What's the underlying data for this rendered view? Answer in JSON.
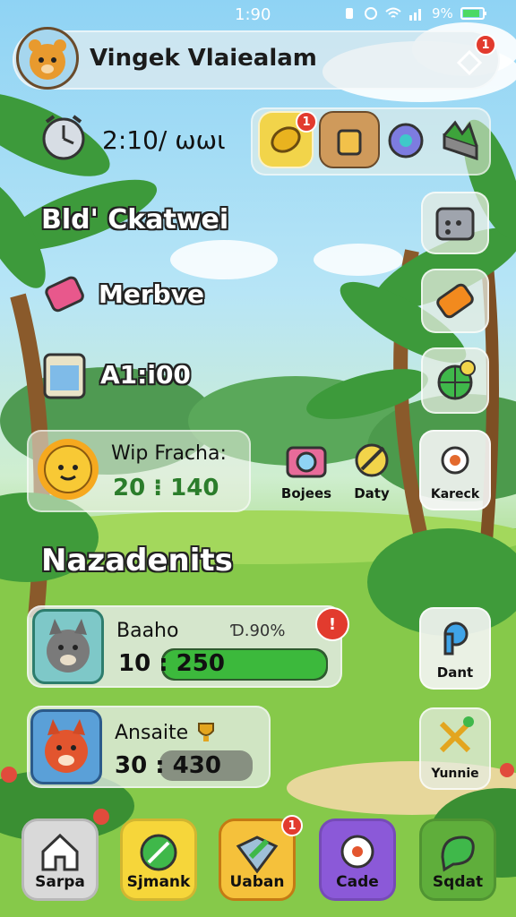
{
  "status_bar": {
    "time": "1:90",
    "battery_pct": "9%",
    "battery_level": 0.8
  },
  "header": {
    "player_name": "Vingek Vlaiealam",
    "badge": "1"
  },
  "top_row": {
    "time_label": "2:10/ ωωι",
    "shortcut_badge": "1"
  },
  "labels": {
    "section_title": "Bld' Ckatwei",
    "menu_label": "Merbve",
    "score_label": "A1:i00"
  },
  "wip_card": {
    "title": "Wip Fracha:",
    "progress_text": "20 ⁝ 140"
  },
  "mid_buttons": {
    "bojees": "Bojees",
    "daty": "Daty",
    "kareck": "Kareck"
  },
  "section2": {
    "title": "Nazadenits"
  },
  "cards": [
    {
      "name": "Baaho",
      "sub": "Ɗ.90%",
      "progress_text": "10 : 250",
      "badge": "!",
      "fill": 0.8
    },
    {
      "name": "Ansaite",
      "progress_text": "30 : 430",
      "fill": 0.55
    }
  ],
  "right_col": {
    "dant": "Dant",
    "yunnie": "Yunnie"
  },
  "bottom_nav": [
    {
      "label": "Sarpa",
      "icon": "home-icon",
      "color": "#d9d9d9"
    },
    {
      "label": "Sjmank",
      "icon": "compass-icon",
      "color": "#f6d63a"
    },
    {
      "label": "Uaban",
      "icon": "map-icon",
      "color": "#f5c13b",
      "badge": "1"
    },
    {
      "label": "Cade",
      "icon": "chat-bubble-icon",
      "color": "#8b59d8"
    },
    {
      "label": "Sqdat",
      "icon": "leaf-chat-icon",
      "color": "#5fae3b"
    }
  ],
  "colors": {
    "accent_red": "#e23b2e",
    "progress_green": "#3cb93c"
  }
}
